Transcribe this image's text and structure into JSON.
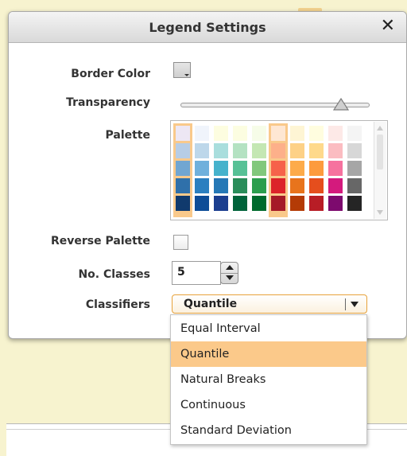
{
  "dialog": {
    "title": "Legend Settings",
    "close_glyph": "✕"
  },
  "labels": {
    "border_color": "Border Color",
    "transparency": "Transparency",
    "palette": "Palette",
    "reverse_palette": "Reverse Palette",
    "no_classes": "No. Classes",
    "classifiers": "Classifiers"
  },
  "border_color": {
    "value": "#d0d0d0"
  },
  "transparency": {
    "value": 0.88
  },
  "palette": {
    "selected_columns": [
      0,
      5
    ],
    "columns": [
      [
        "#ede7f4",
        "#b7cde6",
        "#71a6d1",
        "#2f70aa",
        "#103a6d"
      ],
      [
        "#f0f4fb",
        "#bdd7ea",
        "#6fb0dc",
        "#2b7fc0",
        "#0d4c97"
      ],
      [
        "#fdfde0",
        "#a9dedd",
        "#46b2cc",
        "#2578b6",
        "#1b3e8f"
      ],
      [
        "#fcfde1",
        "#b4e2c2",
        "#57c196",
        "#2a8d5a",
        "#00633a"
      ],
      [
        "#f6fce8",
        "#c4e7b3",
        "#81c87c",
        "#2c9e4e",
        "#006a2d"
      ],
      [
        "#fee7d3",
        "#fdb08a",
        "#f6624a",
        "#dc2329",
        "#a51a27"
      ],
      [
        "#fef5d4",
        "#fdd186",
        "#fdab4a",
        "#e8741c",
        "#b43b06"
      ],
      [
        "#fffddf",
        "#fed98b",
        "#fd9b3e",
        "#e54e1d",
        "#b81d26"
      ],
      [
        "#fde9e7",
        "#fbbcc1",
        "#f6729f",
        "#d41a7d",
        "#7d0a6e"
      ],
      [
        "#f4f4f4",
        "#d7d7d7",
        "#a6a6a6",
        "#676767",
        "#252525"
      ]
    ],
    "scroll_up_icon": "arrow-up-icon",
    "scroll_down_icon": "arrow-down-icon"
  },
  "reverse_palette": {
    "checked": false
  },
  "no_classes": {
    "value": "5"
  },
  "classifiers": {
    "selected": "Quantile",
    "options": [
      "Equal Interval",
      "Quantile",
      "Natural Breaks",
      "Continuous",
      "Standard Deviation"
    ],
    "highlighted_index": 1
  },
  "colors": {
    "accent": "#fbc98a",
    "accent_border": "#e7a23a",
    "background": "#f7f3cf"
  }
}
